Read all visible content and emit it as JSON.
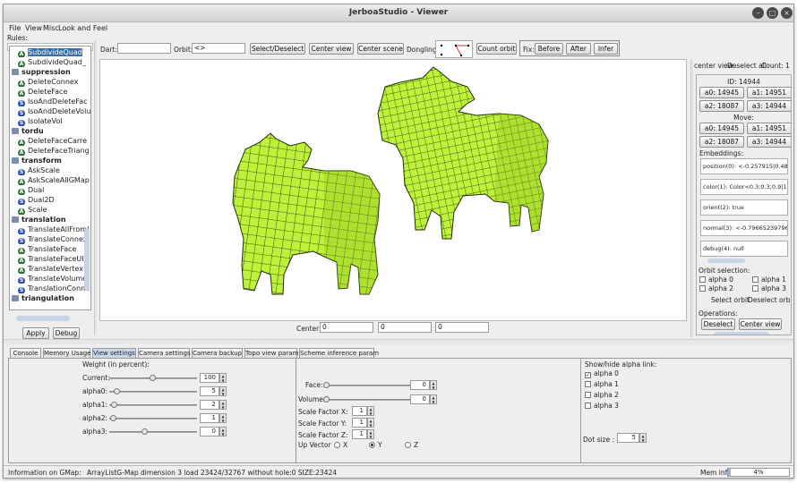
{
  "window": {
    "title": "JerboaStudio - Viewer"
  },
  "menu": [
    "File",
    "View",
    "Misc",
    "Look and Feel"
  ],
  "rules": {
    "label": "Rules:",
    "items": [
      {
        "kind": "leaf",
        "icon": "A",
        "text": "SubdivideQuad",
        "selected": true
      },
      {
        "kind": "leaf",
        "icon": "A",
        "text": "SubdivideQuad_"
      },
      {
        "kind": "cat",
        "text": "suppression"
      },
      {
        "kind": "leaf",
        "icon": "A",
        "text": "DeleteConnex"
      },
      {
        "kind": "leaf",
        "icon": "A",
        "text": "DeleteFace"
      },
      {
        "kind": "leaf",
        "icon": "S",
        "text": "IsoAndDeleteFac"
      },
      {
        "kind": "leaf",
        "icon": "S",
        "text": "IsoAndDeleteVolu"
      },
      {
        "kind": "leaf",
        "icon": "S",
        "text": "IsolateVol"
      },
      {
        "kind": "cat",
        "text": "tordu"
      },
      {
        "kind": "leaf",
        "icon": "A",
        "text": "DeleteFaceCarre"
      },
      {
        "kind": "leaf",
        "icon": "A",
        "text": "DeleteFaceTriang"
      },
      {
        "kind": "cat",
        "text": "transform"
      },
      {
        "kind": "leaf",
        "icon": "S",
        "text": "AskScale"
      },
      {
        "kind": "leaf",
        "icon": "A",
        "text": "AskScaleAllGMap"
      },
      {
        "kind": "leaf",
        "icon": "A",
        "text": "Dual"
      },
      {
        "kind": "leaf",
        "icon": "S",
        "text": "Dual2D"
      },
      {
        "kind": "leaf",
        "icon": "A",
        "text": "Scale"
      },
      {
        "kind": "cat",
        "text": "translation"
      },
      {
        "kind": "leaf",
        "icon": "S",
        "text": "TranslateAllFromI"
      },
      {
        "kind": "leaf",
        "icon": "S",
        "text": "TranslateConnex"
      },
      {
        "kind": "leaf",
        "icon": "A",
        "text": "TranslateFace"
      },
      {
        "kind": "leaf",
        "icon": "A",
        "text": "TranslateFaceUI"
      },
      {
        "kind": "leaf",
        "icon": "A",
        "text": "TranslateVertex"
      },
      {
        "kind": "leaf",
        "icon": "S",
        "text": "TranslateVolume"
      },
      {
        "kind": "leaf",
        "icon": "S",
        "text": "TranslationConne"
      },
      {
        "kind": "cat",
        "text": "triangulation"
      }
    ],
    "apply": "Apply",
    "debug": "Debug"
  },
  "toolbar": {
    "dart_label": "Dart:",
    "dart_value": "",
    "orbit_label": "Orbit:",
    "orbit_value": "<>",
    "select_deselect": "Select/Deselect",
    "center_view": "Center view",
    "center_scene": "Center scene",
    "dongling": "Dongling:",
    "count_orbit": "Count orbit",
    "fix": "Fix:",
    "before": "Before",
    "after": "After",
    "infer": "Infer"
  },
  "center": {
    "label": "Center:",
    "x": "0",
    "y": "0",
    "z": "0"
  },
  "right": {
    "center_view": "center view",
    "deselect_all": "Deselect all",
    "count": "Count: 1",
    "id": "ID: 14944",
    "a": [
      {
        "label": "a0: 14945"
      },
      {
        "label": "a1: 14951"
      },
      {
        "label": "a2: 18087"
      },
      {
        "label": "a3: 14944"
      }
    ],
    "move_label": "Move:",
    "move": [
      {
        "label": "a0: 14945"
      },
      {
        "label": "a1: 14951"
      },
      {
        "label": "a2: 18087"
      },
      {
        "label": "a3: 14944"
      }
    ],
    "embeddings_label": "Embeddings:",
    "embeddings": [
      "position(0): <-0.257915|0.4885",
      "color(1): Color<0.3;0.3;0.9|1.0",
      "orient(2): true",
      "normal(3): <-0.796652397967",
      "debug(4): null"
    ],
    "orbit_sel_label": "Orbit selection:",
    "alphas": [
      "alpha 0",
      "alpha 1",
      "alpha 2",
      "alpha 3"
    ],
    "select_orbit": "Select orbit",
    "deselect_orbit": "Deselect orbit",
    "operations_label": "Operations:",
    "deselect": "Deselect",
    "center_view_btn": "Center view"
  },
  "tabs": [
    "Console",
    "Memory Usage",
    "View settings",
    "Camera settings",
    "Camera backup",
    "Topo view param",
    "Scheme inference param"
  ],
  "active_tab": 2,
  "weights": {
    "title": "Weight (in percent):",
    "rows": [
      {
        "label": "Current:",
        "value": "100",
        "pos": 0.5
      },
      {
        "label": "alpha0:",
        "value": "5",
        "pos": 0.05
      },
      {
        "label": "alpha1:",
        "value": "2",
        "pos": 0.02
      },
      {
        "label": "alpha2:",
        "value": "1",
        "pos": 0.01
      },
      {
        "label": "alpha3:",
        "value": "0",
        "pos": 0.4
      }
    ]
  },
  "view": {
    "face_label": "Face:",
    "face": "0",
    "volume_label": "Volume:",
    "volume": "0",
    "sx_label": "Scale Factor X:",
    "sx": "1",
    "sy_label": "Scale Factor Y:",
    "sy": "1",
    "sz_label": "Scale Factor Z:",
    "sz": "1",
    "up_label": "Up Vector",
    "up": [
      "X",
      "Y",
      "Z"
    ],
    "up_sel": 1
  },
  "alpha_links": {
    "title": "Show/hide alpha link:",
    "items": [
      {
        "label": "alpha 0",
        "checked": true
      },
      {
        "label": "alpha 1",
        "checked": false
      },
      {
        "label": "alpha 2",
        "checked": false
      },
      {
        "label": "alpha 3",
        "checked": false
      }
    ],
    "dot_label": "Dot size :",
    "dot": "5"
  },
  "status": {
    "info": "Information on GMap:",
    "detail": "ArrayListG-Map dimension 3 load 23424/32767 without hole:0 SIZE:23424",
    "mem_label": "Mem info:",
    "mem": "4%"
  },
  "colors": {
    "mesh": "#bef23a",
    "mesh_dark": "#8fbf1c",
    "selection": "#3a6ea5",
    "icon_A": "#2e6f3c",
    "icon_S": "#2c4fb0"
  }
}
